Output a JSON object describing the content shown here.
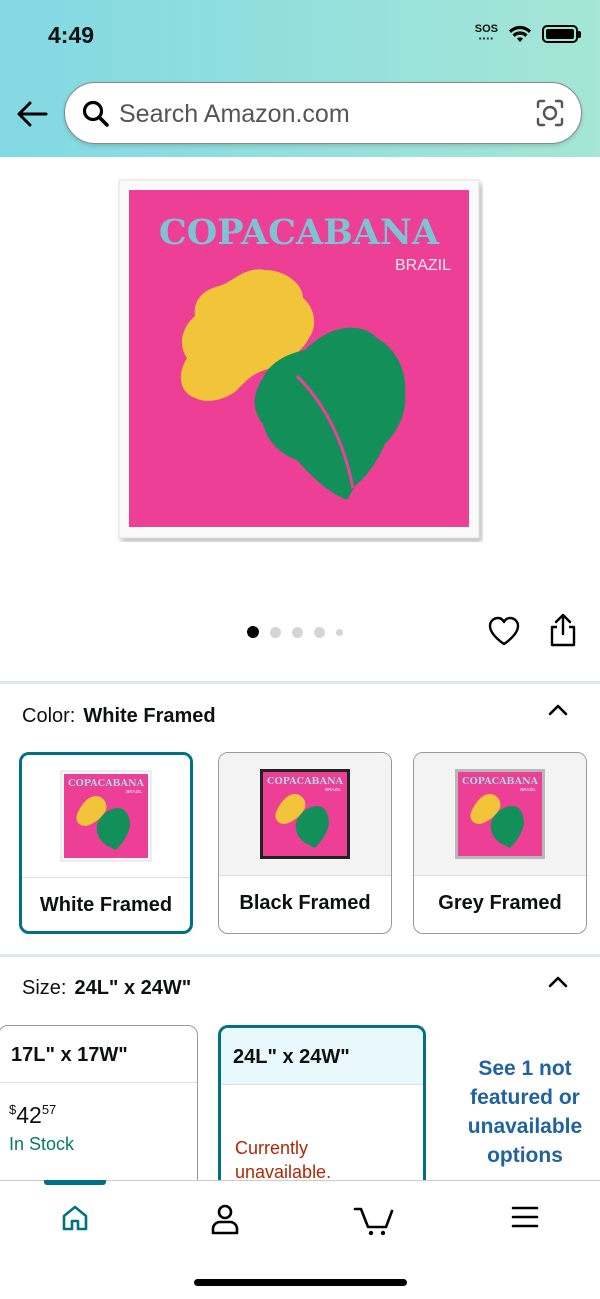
{
  "status_bar": {
    "time": "4:49",
    "sos": "SOS"
  },
  "search": {
    "placeholder": "Search Amazon.com"
  },
  "product_image": {
    "title": "COPACABANA",
    "subtitle": "BRAZIL",
    "image_count": 5,
    "current_index": 1
  },
  "color": {
    "label": "Color:",
    "selected": "White Framed",
    "options": [
      "White Framed",
      "Black Framed",
      "Grey Framed"
    ],
    "thumb_title": "COPACABANA",
    "thumb_subtitle": "BRAZIL"
  },
  "size": {
    "label": "Size:",
    "selected": "24L\" x 24W\"",
    "options": [
      {
        "name": "17L\" x 17W\"",
        "price_whole": "42",
        "price_fraction": "57",
        "currency": "$",
        "availability": "In Stock"
      },
      {
        "name": "24L\" x 24W\"",
        "availability": "Currently unavailable."
      }
    ],
    "see_more": "See 1 not featured or unavailable options"
  },
  "bottom_nav": {
    "items": [
      "home-icon",
      "account-icon",
      "cart-icon",
      "menu-icon"
    ],
    "active": "home-icon"
  },
  "colors": {
    "accent": "#007185",
    "link": "#2162a1",
    "in_stock": "#067d62",
    "unavailable": "#b12704",
    "poster_pink": "#ec3f95"
  }
}
